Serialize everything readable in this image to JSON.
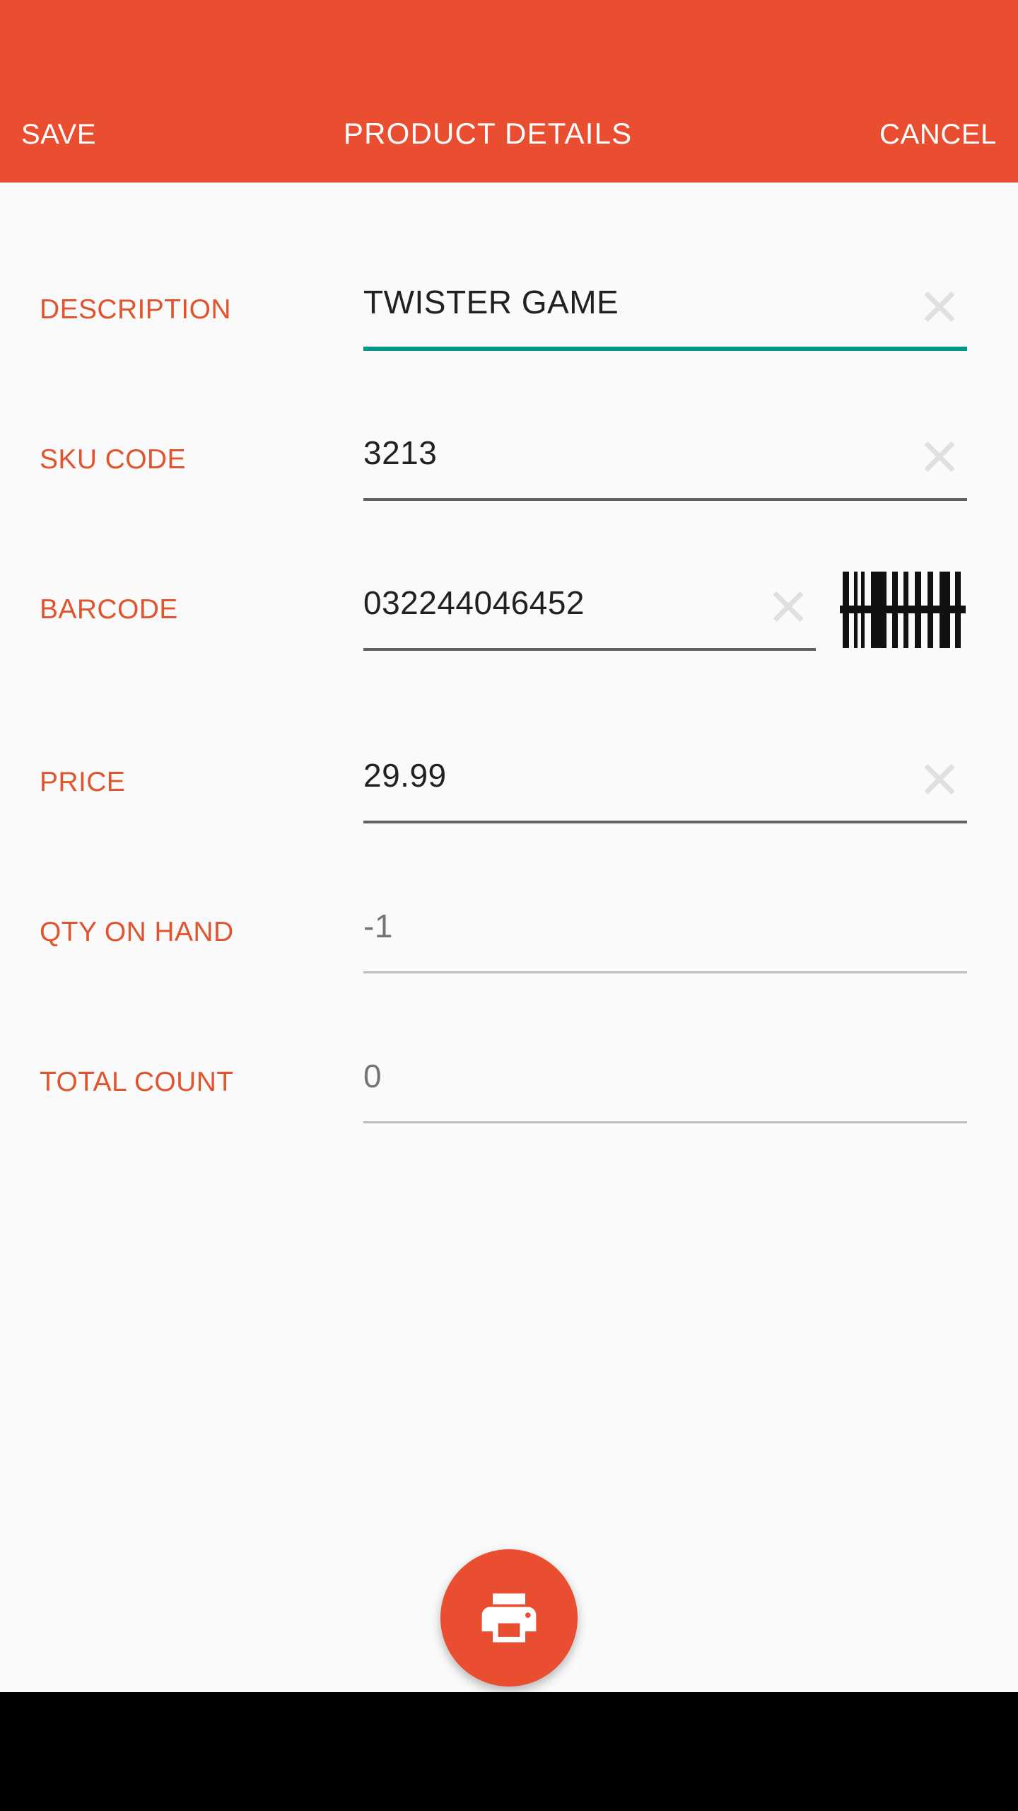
{
  "appbar": {
    "save_label": "SAVE",
    "title": "PRODUCT DETAILS",
    "cancel_label": "CANCEL",
    "background_color": "#e94e31",
    "text_color": "#ffffff"
  },
  "theme": {
    "accent_color": "#e94e31",
    "label_color": "#e0552f",
    "focus_underline_color": "#009688",
    "underline_color": "#616161",
    "muted_underline_color": "#bdbdbd",
    "value_color": "#212121",
    "placeholder_color": "#b3b3b3",
    "page_background": "#fafafa",
    "navbar_color": "#000000"
  },
  "fields": [
    {
      "label": "DESCRIPTION",
      "value": "TWISTER GAME",
      "is_placeholder": false,
      "focused": true,
      "has_clear": true,
      "has_scan": false,
      "clear_icon": "close-x-icon"
    },
    {
      "label": "SKU CODE",
      "value": "3213",
      "is_placeholder": false,
      "focused": false,
      "has_clear": true,
      "has_scan": false,
      "clear_icon": "close-x-icon"
    },
    {
      "label": "BARCODE",
      "value": "032244046452",
      "is_placeholder": false,
      "focused": false,
      "has_clear": true,
      "has_scan": true,
      "clear_icon": "close-x-icon",
      "scan_icon": "barcode-scan-icon"
    },
    {
      "label": "PRICE",
      "value": "29.99",
      "is_placeholder": false,
      "focused": false,
      "has_clear": true,
      "has_scan": false,
      "clear_icon": "close-x-icon"
    },
    {
      "label": "QTY ON HAND",
      "value": "-1",
      "is_placeholder": true,
      "focused": false,
      "has_clear": false,
      "has_scan": false
    },
    {
      "label": "TOTAL COUNT",
      "value": "0",
      "is_placeholder": true,
      "focused": false,
      "has_clear": false,
      "has_scan": false
    }
  ],
  "fab": {
    "icon": "printer-icon",
    "color": "#e94e31"
  }
}
